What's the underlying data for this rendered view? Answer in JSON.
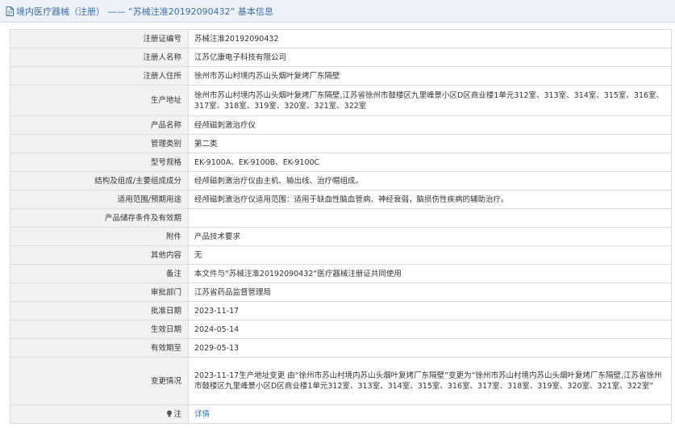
{
  "header": {
    "title": "境内医疗器械（注册） —— “苏械注准20192090432” 基本信息",
    "icon": "document-icon"
  },
  "rows": [
    {
      "label": "注册证编号",
      "value": "苏械注准20192090432"
    },
    {
      "label": "注册人名称",
      "value": "江苏亿康电子科技有限公司"
    },
    {
      "label": "注册人住所",
      "value": "徐州市苏山村境内苏山头烟叶复烤厂东隔壁"
    },
    {
      "label": "生产地址",
      "value": "徐州市苏山村境内苏山头烟叶复烤厂东隔壁,江苏省徐州市鼓楼区九里峰景小区D区商业楼1单元312室、313室、314室、315室、316室、317室、318室、319室、320室、321室、322室"
    },
    {
      "label": "产品名称",
      "value": "经颅磁刺激治疗仪"
    },
    {
      "label": "管理类别",
      "value": "第二类"
    },
    {
      "label": "型号规格",
      "value": "EK-9100A、EK-9100B、EK-9100C"
    },
    {
      "label": "结构及组成/主要组成成分",
      "value": "经颅磁刺激治疗仪由主机、输出线、治疗帽组成。"
    },
    {
      "label": "适用范围/预期用途",
      "value": "经颅磁刺激治疗仪适用范围：适用于缺血性脑血管病、神经衰弱，脑损伤性疾病的辅助治疗。"
    },
    {
      "label": "产品储存条件及有效期",
      "value": ""
    },
    {
      "label": "附件",
      "value": "产品技术要求"
    },
    {
      "label": "其他内容",
      "value": "无"
    },
    {
      "label": "备注",
      "value": "本文件与“苏械注准20192090432”医疗器械注册证共同使用"
    },
    {
      "label": "审批部门",
      "value": "江苏省药品监督管理局"
    },
    {
      "label": "批准日期",
      "value": "2023-11-17"
    },
    {
      "label": "生效日期",
      "value": "2024-05-14"
    },
    {
      "label": "有效期至",
      "value": "2029-05-13"
    },
    {
      "label": "变更情况",
      "value": "2023-11-17生产地址变更 由“徐州市苏山村境内苏山头烟叶复烤厂东隔壁”变更为“徐州市苏山村境内苏山头烟叶复烤厂东隔壁,江苏省徐州市鼓楼区九里峰景小区D区商业楼1单元312室、313室、314室、315室、316室、317室、318室、319室、320室、321室、322室”"
    }
  ],
  "note": {
    "label": "注",
    "icon": "bulb-icon",
    "link_text": "详情"
  }
}
